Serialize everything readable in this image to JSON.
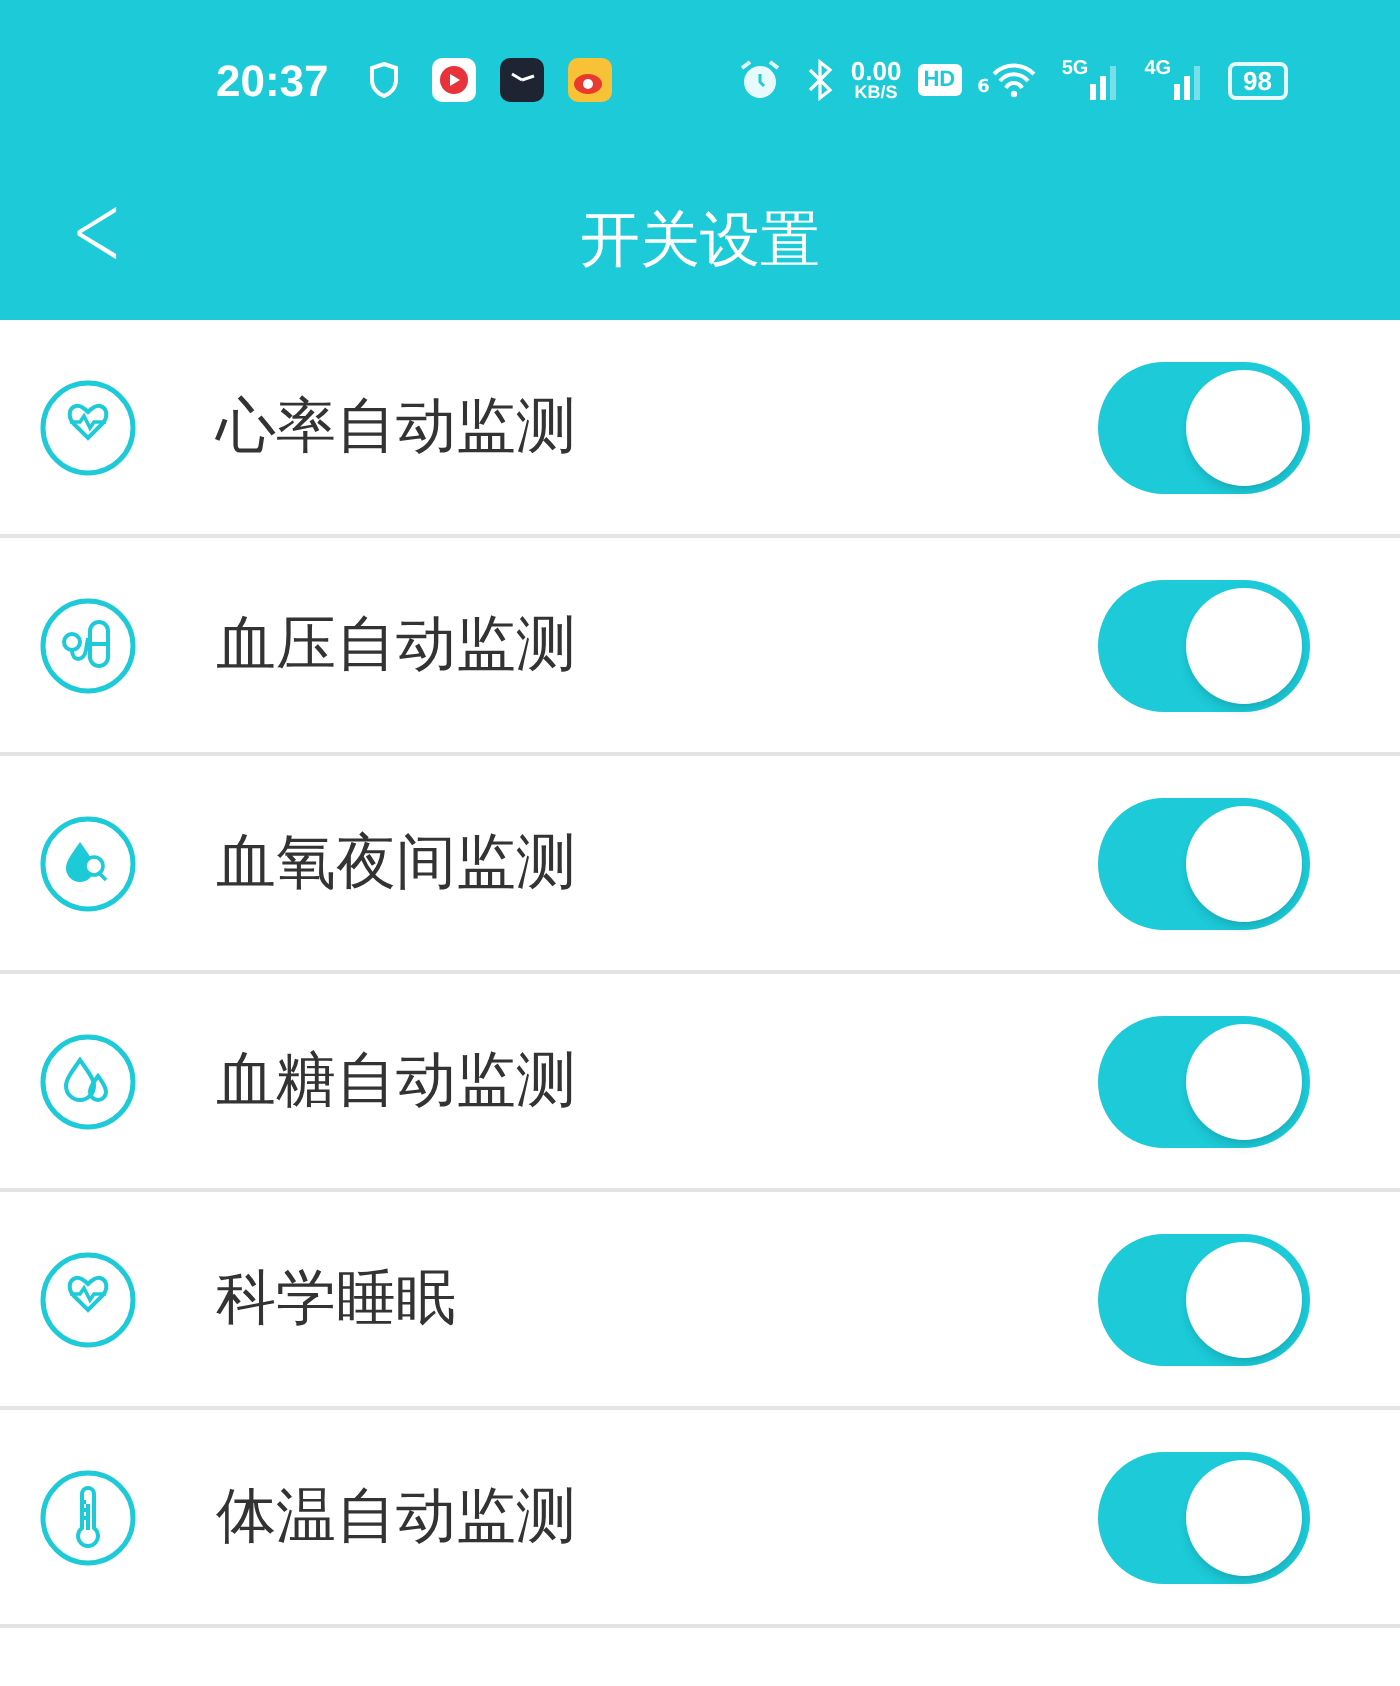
{
  "status_bar": {
    "time": "20:37",
    "net_speed": "0.00",
    "net_unit": "KB/S",
    "hd": "HD",
    "wifi_gen": "6",
    "sim1": "5G",
    "sim2": "4G",
    "battery": "98"
  },
  "header": {
    "back": "<",
    "title": "开关设置"
  },
  "settings": [
    {
      "kind": "heart",
      "label": "心率自动监测",
      "on": true
    },
    {
      "kind": "pill",
      "label": "血压自动监测",
      "on": true
    },
    {
      "kind": "drop-search",
      "label": "血氧夜间监测",
      "on": true
    },
    {
      "kind": "drops",
      "label": "血糖自动监测",
      "on": true
    },
    {
      "kind": "heart",
      "label": "科学睡眠",
      "on": true
    },
    {
      "kind": "thermometer",
      "label": "体温自动监测",
      "on": true
    }
  ]
}
